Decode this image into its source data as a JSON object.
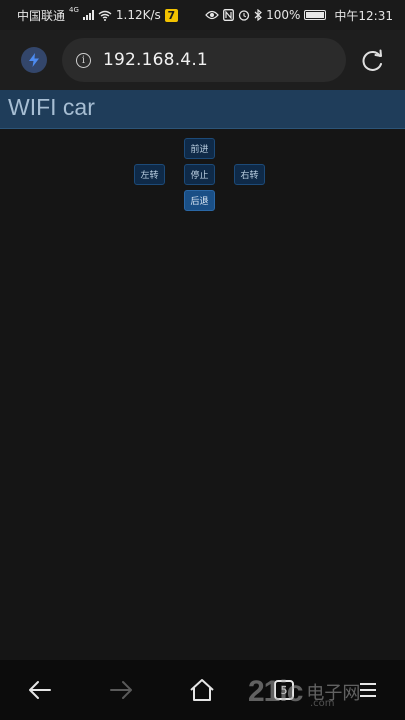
{
  "status_bar": {
    "carrier": "中国联通",
    "network_tag": "4G",
    "speed": "1.12K/s",
    "app_badge": "7",
    "battery": "100%",
    "time": "中午12:31",
    "icons": [
      "signal-icon",
      "wifi-icon",
      "eye-icon",
      "nfc-icon",
      "alarm-icon",
      "bluetooth-icon",
      "battery-icon"
    ]
  },
  "browser": {
    "url": "192.168.4.1",
    "icons": [
      "lightning-icon",
      "info-icon",
      "reload-icon"
    ]
  },
  "page": {
    "title": "WIFI car",
    "controls": {
      "forward": "前进",
      "left": "左转",
      "stop": "停止",
      "right": "右转",
      "backward": "后退"
    },
    "active_control": "backward"
  },
  "nav_bar": {
    "icons": [
      "back-arrow-icon",
      "forward-arrow-icon",
      "home-icon",
      "tabs-icon",
      "menu-icon"
    ],
    "tab_count": "5"
  },
  "watermark": {
    "main": "21ic",
    "cn": "电子网",
    "domain": ".com"
  },
  "colors": {
    "header_bg": "#1f3d5a",
    "button_bg": "#0f2a48",
    "button_active_bg": "#1a4f86",
    "page_bg": "#151515"
  }
}
